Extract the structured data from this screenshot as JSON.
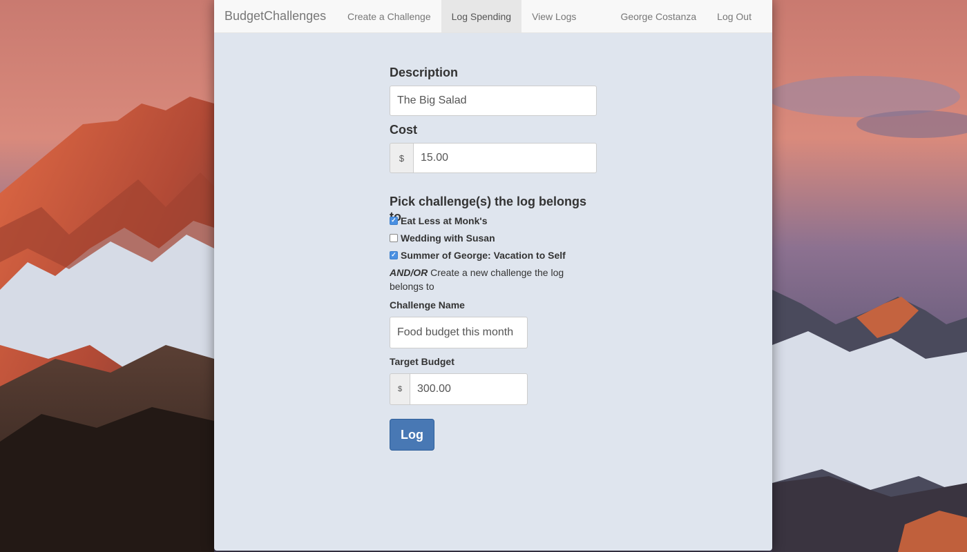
{
  "navbar": {
    "brand": "BudgetChallenges",
    "links": [
      "Create a Challenge",
      "Log Spending",
      "View Logs"
    ],
    "active_link": "Log Spending",
    "user_name": "George Costanza",
    "logout": "Log Out"
  },
  "form": {
    "description_label": "Description",
    "description_value": "The Big Salad",
    "cost_label": "Cost",
    "currency_symbol": "$",
    "cost_value": "15.00",
    "pick_heading": "Pick challenge(s) the log belongs to",
    "challenges": [
      {
        "label": "Eat Less at Monk's",
        "checked": true
      },
      {
        "label": "Wedding with Susan",
        "checked": false
      },
      {
        "label": "Summer of George: Vacation to Self",
        "checked": true
      }
    ],
    "andor_emphasis": "AND/OR",
    "andor_text": " Create a new challenge the log belongs to",
    "challenge_name_label": "Challenge Name",
    "challenge_name_value": "Food budget this month",
    "target_budget_label": "Target Budget",
    "target_budget_value": "300.00",
    "submit_label": "Log"
  },
  "colors": {
    "window_bg": "#dfe5ee",
    "navbar_bg": "#f8f8f8",
    "button_bg": "#4878b4",
    "checkbox_checked": "#4a90e2"
  }
}
